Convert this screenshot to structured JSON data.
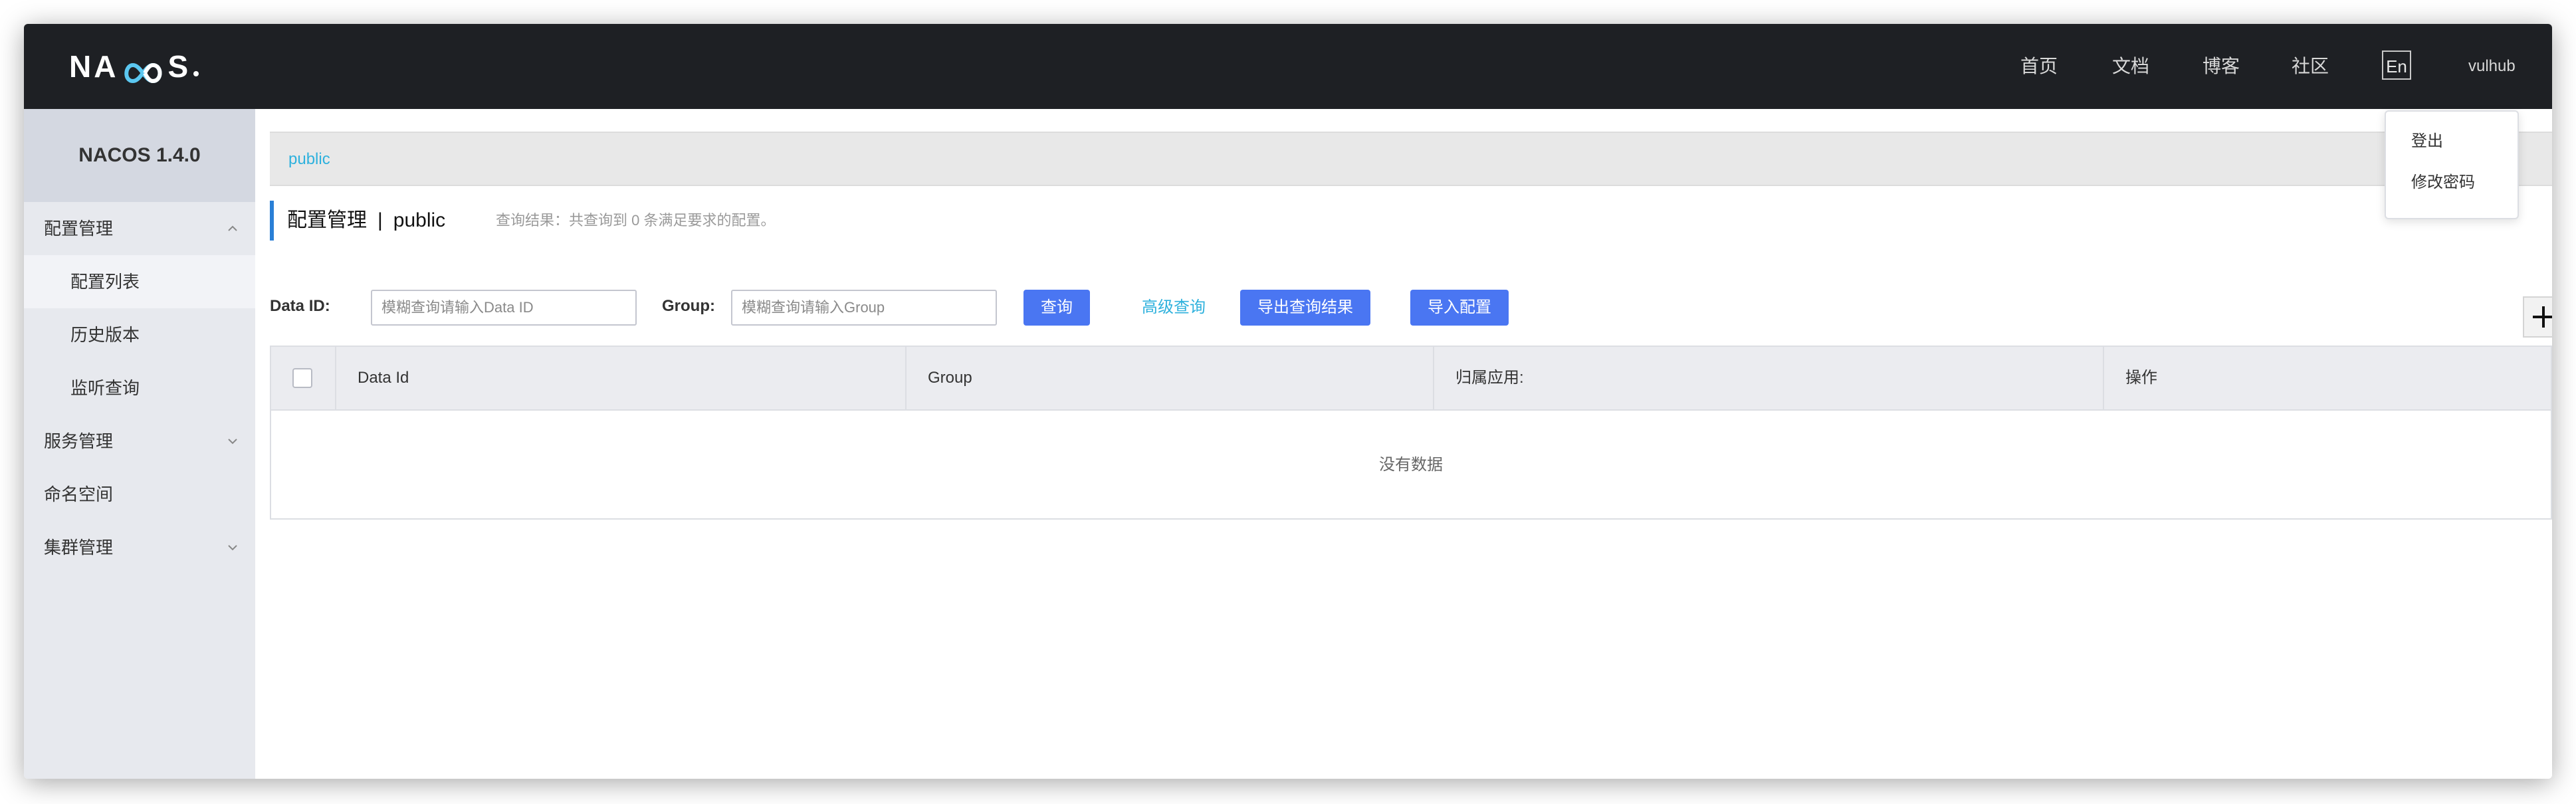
{
  "header": {
    "logo_text_left": "NA",
    "logo_text_right": "S",
    "nav": {
      "home": "首页",
      "docs": "文档",
      "blog": "博客",
      "community": "社区"
    },
    "lang_button": "En",
    "user": "vulhub"
  },
  "user_menu": {
    "items": [
      "登出",
      "修改密码"
    ]
  },
  "sidebar": {
    "version": "NACOS 1.4.0",
    "config_management": "配置管理",
    "config_list": "配置列表",
    "history": "历史版本",
    "listener_query": "监听查询",
    "service_management": "服务管理",
    "namespace": "命名空间",
    "cluster_management": "集群管理"
  },
  "main": {
    "namespace_tab": "public",
    "title_section": "配置管理",
    "title_separator": "|",
    "title_namespace": "public",
    "query_result": "查询结果：共查询到 0 条满足要求的配置。",
    "data_id_label": "Data ID:",
    "data_id_placeholder": "模糊查询请输入Data ID",
    "group_label": "Group:",
    "group_placeholder": "模糊查询请输入Group",
    "query_button": "查询",
    "advanced_query": "高级查询",
    "export_button": "导出查询结果",
    "import_button": "导入配置"
  },
  "table": {
    "columns": [
      "Data Id",
      "Group",
      "归属应用:",
      "操作"
    ],
    "empty": "没有数据"
  },
  "colors": {
    "header_bg": "#1e2024",
    "sidebar_bg": "#e7e9ee",
    "primary_button": "#4a76f2",
    "link": "#2eb1dd",
    "title_accent": "#2a7fd6"
  }
}
